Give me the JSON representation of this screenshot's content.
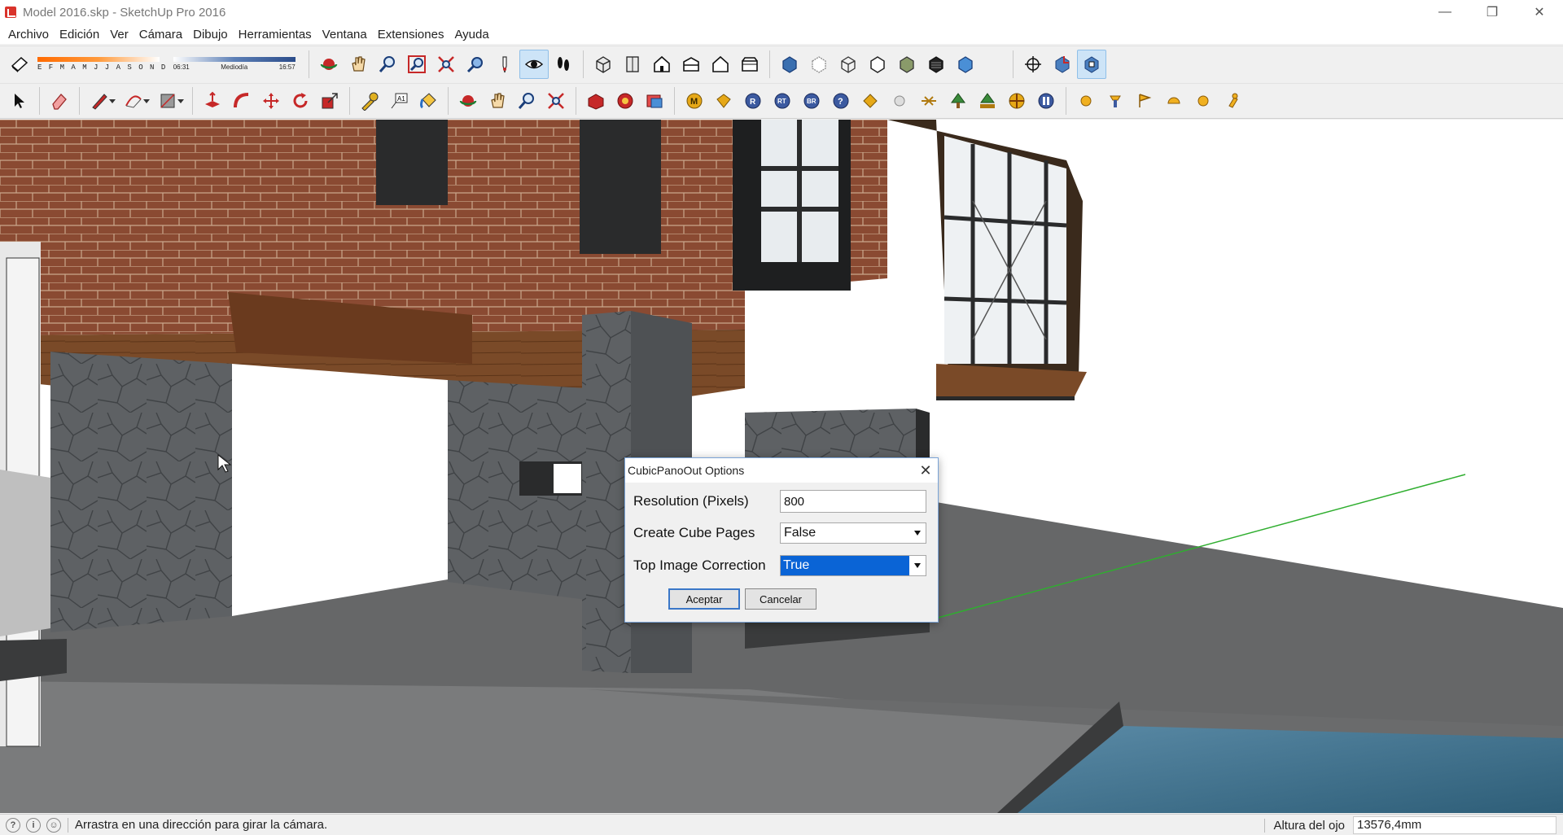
{
  "window": {
    "title": "Model 2016.skp - SketchUp Pro 2016",
    "controls": {
      "minimize": "—",
      "maximize": "❐",
      "close": "✕"
    }
  },
  "menu": [
    "Archivo",
    "Edición",
    "Ver",
    "Cámara",
    "Dibujo",
    "Herramientas",
    "Ventana",
    "Extensiones",
    "Ayuda"
  ],
  "shadow_settings": {
    "months": "E F M A M J J A S O N D",
    "time_start": "06:31",
    "time_mid": "Mediodía",
    "time_end": "16:57"
  },
  "toolbar1": {
    "icons": [
      "shadow-toggle-icon",
      "orbit-icon",
      "pan-icon",
      "zoom-icon",
      "zoom-window-icon",
      "zoom-extents-icon",
      "previous-view-icon",
      "position-camera-icon",
      "look-around-icon",
      "walk-icon",
      "iso-view-icon",
      "top-view-icon",
      "front-view-icon",
      "right-view-icon",
      "back-view-icon",
      "left-view-icon",
      "xray-icon",
      "back-edges-icon",
      "wireframe-icon",
      "hidden-line-icon",
      "shaded-icon",
      "shaded-textures-icon",
      "monochrome-icon",
      "section-plane-icon",
      "display-section-icon",
      "section-cuts-icon"
    ],
    "active": "look-around-icon"
  },
  "toolbar2": {
    "icons": [
      "select-icon",
      "eraser-icon",
      "line-icon",
      "arc-icon",
      "rectangle-icon",
      "push-pull-icon",
      "follow-me-icon",
      "move-icon",
      "rotate-icon",
      "scale-icon",
      "tape-measure-icon",
      "text-icon",
      "paint-bucket-icon",
      "orbit-icon",
      "pan-icon",
      "zoom-icon",
      "zoom-extents-icon",
      "warehouse-icon",
      "extension-warehouse-icon",
      "layout-icon",
      "plugin-m-icon",
      "plugin-tag-icon",
      "plugin-r-icon",
      "plugin-rt-icon",
      "plugin-br-icon",
      "plugin-help-icon",
      "plugin-tag2-icon",
      "plugin-sphere-icon",
      "plugin-cross-icon",
      "plugin-tree-icon",
      "plugin-tree2-icon",
      "plugin-target-icon",
      "plugin-pause-icon",
      "plugin-ball-icon",
      "plugin-lamp-icon",
      "plugin-flag-icon",
      "plugin-dome-icon",
      "plugin-ball2-icon",
      "plugin-pin-icon"
    ]
  },
  "dialog": {
    "title": "CubicPanoOut Options",
    "close": "✕",
    "fields": [
      {
        "label": "Resolution (Pixels)",
        "value": "800"
      },
      {
        "label": "Create Cube Pages",
        "value": "False"
      },
      {
        "label": "Top Image Correction",
        "value": "True"
      }
    ],
    "ok_label": "Aceptar",
    "cancel_label": "Cancelar"
  },
  "status": {
    "message": "Arrastra en una dirección para girar la cámara.",
    "vcb_label": "Altura del ojo",
    "vcb_value": "13576,4mm"
  },
  "colors": {
    "brick": "#8a4a32",
    "stone": "#5c5f62",
    "axis_green": "#2fae2f",
    "water": "#3c6f8a",
    "dialog_focus": "#0a64d6"
  }
}
